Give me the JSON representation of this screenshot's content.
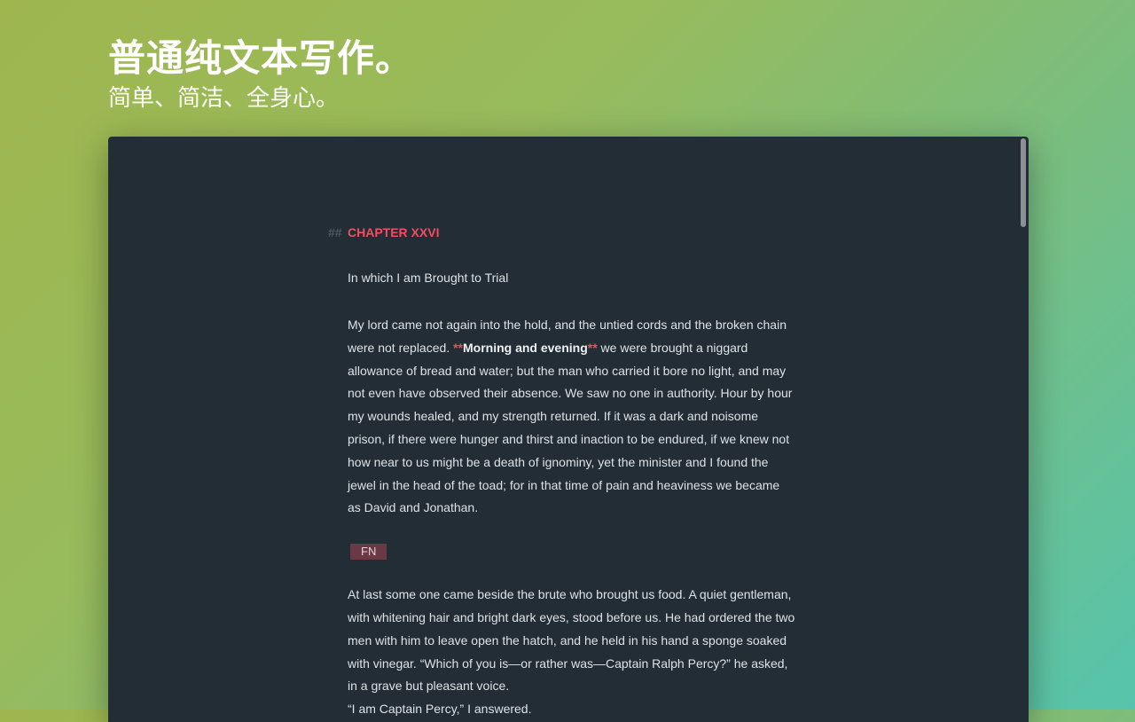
{
  "hero": {
    "title": "普通纯文本写作。",
    "subtitle": "简单、简洁、全身心。"
  },
  "document": {
    "heading_marker": "##",
    "heading": "CHAPTER XXVI",
    "subtitle": "In which I am Brought to Trial",
    "paragraph1": {
      "before": "My lord came not again into the hold, and the untied cords and the broken chain were not replaced. ",
      "bold_open": "**",
      "bold_text": "Morning and evening",
      "bold_close": "**",
      "after": " we were brought a niggard allowance of bread and water; but the man who carried it bore no light, and may not even have observed their absence. We saw no one in authority. Hour by hour my wounds healed, and my strength returned. If it was a dark and noisome prison, if there were hunger and thirst and inaction to be endured, if we knew not how near to us might be a death of ignominy, yet the minister and I found the jewel in the head of the toad; for in that time of pain and heaviness we became as David and Jonathan."
    },
    "footnote_tag": "FN",
    "paragraph2": "At last some one came beside the brute who brought us food. A quiet gentleman, with whitening hair and bright dark eyes, stood before us. He had ordered the two men with him to leave open the hatch, and he held in his hand a sponge soaked with vinegar. “Which of you is—or rather was—Captain Ralph Percy?” he asked, in a grave but pleasant voice.",
    "paragraph3": "“I am Captain Percy,” I answered."
  },
  "colors": {
    "editor_background": "#232d35",
    "accent_red": "#ef4f5f",
    "text": "#dde2e6"
  }
}
